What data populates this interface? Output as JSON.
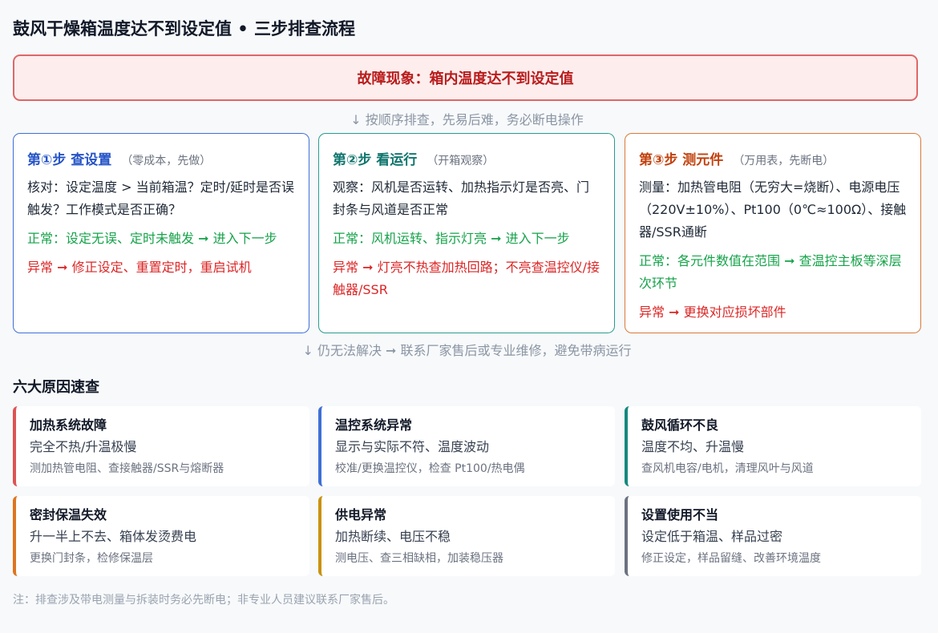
{
  "title": "鼓风干燥箱温度达不到设定值 • 三步排查流程",
  "fault": "故障现象：箱内温度达不到设定值",
  "hint_top": "↓ 按顺序排查，先易后难，务必断电操作",
  "steps": [
    {
      "title": "第①步 查设置",
      "subtitle": "（零成本，先做）",
      "check": "核对：设定温度 > 当前箱温？定时/延时是否误触发？工作模式是否正确？",
      "ok": "正常：设定无误、定时未触发 ➞ 进入下一步",
      "bad": "异常 ➞ 修正设定、重置定时，重启试机"
    },
    {
      "title": "第②步 看运行",
      "subtitle": "（开箱观察）",
      "check": "观察：风机是否运转、加热指示灯是否亮、门封条与风道是否正常",
      "ok": "正常：风机运转、指示灯亮 ➞ 进入下一步",
      "bad": "异常 ➞ 灯亮不热查加热回路；不亮查温控仪/接触器/SSR"
    },
    {
      "title": "第③步 测元件",
      "subtitle": "（万用表，先断电）",
      "check": "测量：加热管电阻（无穷大=烧断）、电源电压（220V±10%）、Pt100（0℃≈100Ω）、接触器/SSR通断",
      "ok": "正常：各元件数值在范围 ➞ 查温控主板等深层次环节",
      "bad": "异常 ➞ 更换对应损坏部件"
    }
  ],
  "hint_bottom": "↓ 仍无法解决 ➞ 联系厂家售后或专业维修，避免带病运行",
  "section_title": "六大原因速查",
  "causes": [
    {
      "head": "加热系统故障",
      "symptom": "完全不热/升温极慢",
      "fix": "测加热管电阻、查接触器/SSR与熔断器"
    },
    {
      "head": "温控系统异常",
      "symptom": "显示与实际不符、温度波动",
      "fix": "校准/更换温控仪，检查 Pt100/热电偶"
    },
    {
      "head": "鼓风循环不良",
      "symptom": "温度不均、升温慢",
      "fix": "查风机电容/电机，清理风叶与风道"
    },
    {
      "head": "密封保温失效",
      "symptom": "升一半上不去、箱体发烫费电",
      "fix": "更换门封条，检修保温层"
    },
    {
      "head": "供电异常",
      "symptom": "加热断续、电压不稳",
      "fix": "测电压、查三相缺相，加装稳压器"
    },
    {
      "head": "设置使用不当",
      "symptom": "设定低于箱温、样品过密",
      "fix": "修正设定，样品留缝、改善环境温度"
    }
  ],
  "note": "注：排查涉及带电测量与拆装时务必先断电；非专业人员建议联系厂家售后。",
  "colors": {
    "fault_border": "#e06767",
    "step1": "#3f6fd6",
    "step2": "#2b9a8f",
    "step3": "#d97a3a",
    "ok": "#16a34a",
    "bad": "#dc2626"
  }
}
